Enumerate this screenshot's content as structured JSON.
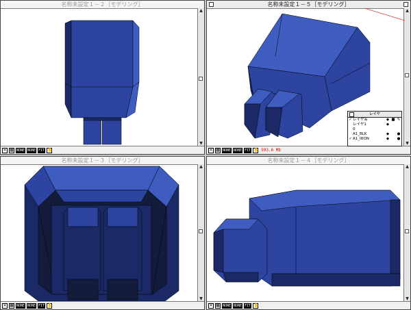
{
  "windows": {
    "top_left": {
      "title": "名称未設定１－２［モデリング］",
      "active": false
    },
    "top_right": {
      "title": "名称未設定１－５［モデリング］",
      "active": true
    },
    "bottom_left": {
      "title": "名称未設定１－３［モデリング］",
      "active": false
    },
    "bottom_right": {
      "title": "名称未設定１－４［モデリング］",
      "active": false
    }
  },
  "statusbar": {
    "xyz_icon": "axes-icon",
    "btn_a": "NONE",
    "btn_b": "NONE",
    "btn_fit": "FIT",
    "readout": "593.6 Mb"
  },
  "layer_panel": {
    "title": "レイヤ",
    "rows": [
      {
        "check": "✓",
        "name": "レイヤ名",
        "f1": "◆",
        "f2": "■",
        "f3": "✎"
      },
      {
        "check": "",
        "name": "レイヤ1",
        "f1": "◆",
        "f2": "",
        "f3": ""
      },
      {
        "check": "",
        "name": "0",
        "f1": "",
        "f2": "",
        "f3": ""
      },
      {
        "check": "",
        "name": "A1_BLK",
        "f1": "◆",
        "f2": "",
        "f3": "●"
      },
      {
        "check": "✓",
        "name": "A1_IRON",
        "f1": "◆",
        "f2": "",
        "f3": "●"
      }
    ]
  },
  "colors": {
    "face_light": "#3f5cc0",
    "face_mid": "#2d45a0",
    "face_dark": "#1b2a66",
    "face_darkest": "#141c3c",
    "readout": "#d00000"
  }
}
